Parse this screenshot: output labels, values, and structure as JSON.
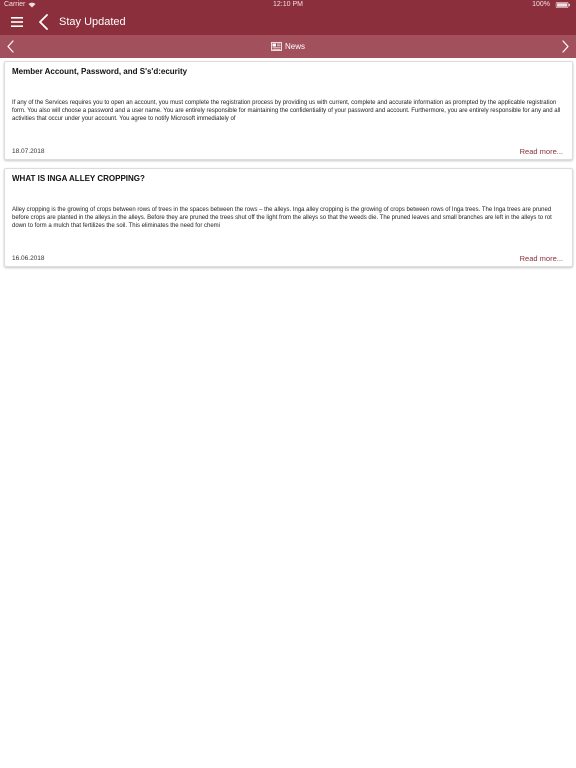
{
  "status_bar": {
    "carrier": "Carrier",
    "time": "12:10 PM",
    "battery": "100%"
  },
  "header": {
    "title": "Stay Updated"
  },
  "subnav": {
    "label": "News"
  },
  "articles": [
    {
      "title": "Member Account, Password, and S's'd:ecurity",
      "body": "If any of the Services requires you to open an account, you must complete the registration process by providing us with current, complete and accurate information as prompted by the applicable registration form. You also will choose a password and a user name. You are entirely responsible for maintaining the confidentiality of your password and account. Furthermore, you are entirely responsible for any and all activities that occur under your account. You agree to notify Microsoft immediately of",
      "date": "18.07.2018",
      "read_more": "Read more..."
    },
    {
      "title": "WHAT IS INGA ALLEY CROPPING?",
      "body": "Alley cropping is the growing of crops between rows of trees in the spaces between the rows – the alleys.  Inga alley cropping is the growing of crops between rows of Inga trees.  The Inga trees are pruned before crops are planted in the alleys.in the alleys. Before they are pruned the trees shut off the light from the alleys so that the weeds die. The pruned leaves and small branches are left in the alleys to rot down to form a mulch that  fertilizes the soil. This eliminates the need for chemi",
      "date": "16.06.2018",
      "read_more": "Read more..."
    }
  ],
  "colors": {
    "header_bg": "#8b2f3d",
    "subnav_bg": "#a2505c",
    "link": "#8b2f3d"
  }
}
